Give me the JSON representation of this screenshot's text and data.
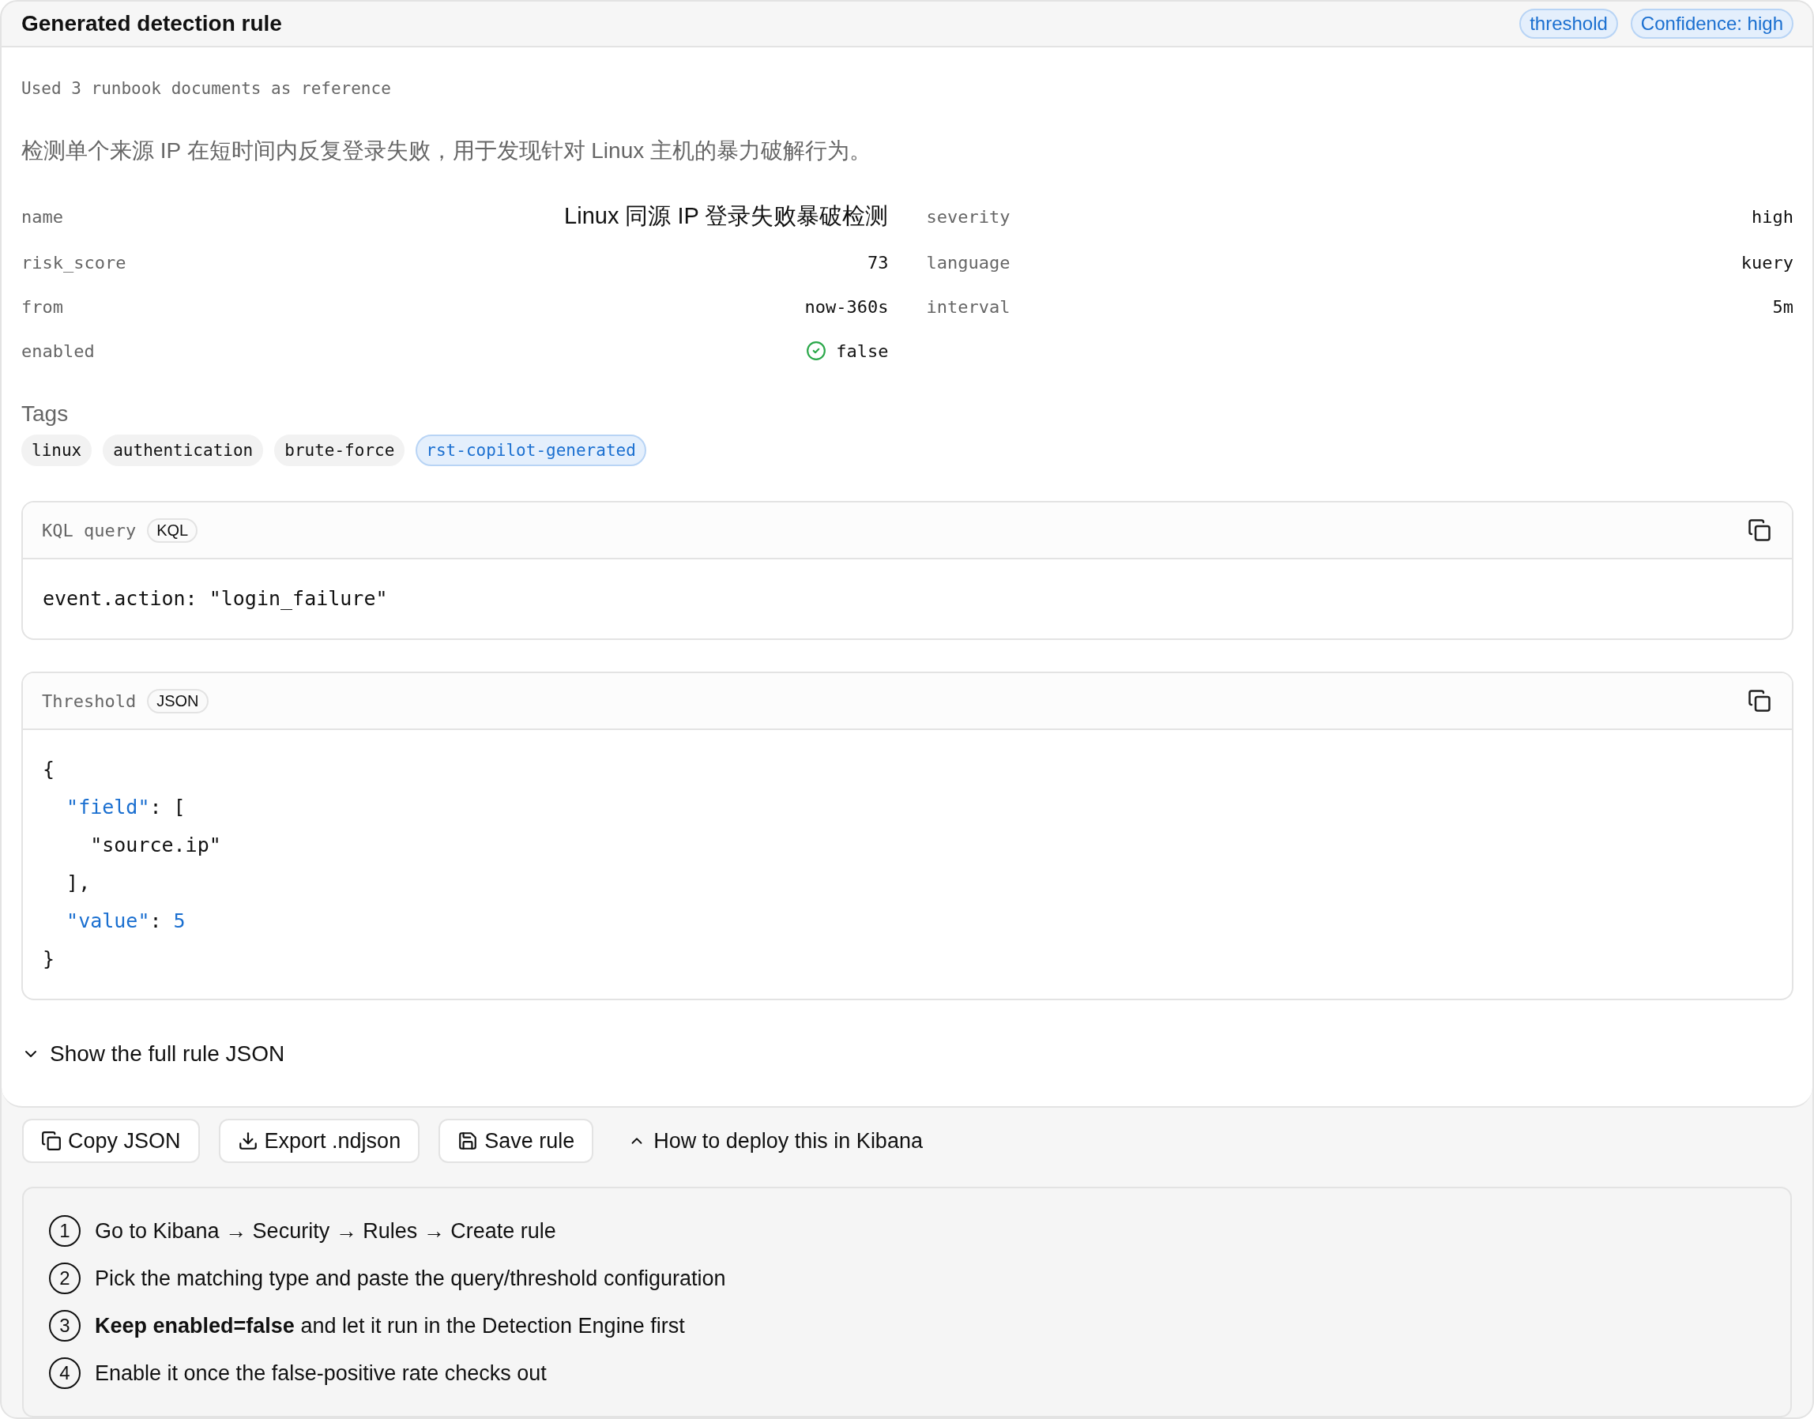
{
  "header": {
    "title": "Generated detection rule",
    "badges": [
      "threshold",
      "Confidence: high"
    ]
  },
  "reference_note": "Used 3 runbook documents as reference",
  "description": "检测单个来源 IP 在短时间内反复登录失败，用于发现针对 Linux 主机的暴力破解行为。",
  "fields": [
    {
      "label": "name",
      "value": "Linux 同源 IP 登录失败暴破检测",
      "kind": "title"
    },
    {
      "label": "severity",
      "value": "high",
      "kind": "mono"
    },
    {
      "label": "risk_score",
      "value": "73",
      "kind": "mono"
    },
    {
      "label": "language",
      "value": "kuery",
      "kind": "mono"
    },
    {
      "label": "from",
      "value": "now-360s",
      "kind": "mono"
    },
    {
      "label": "interval",
      "value": "5m",
      "kind": "mono"
    },
    {
      "label": "enabled",
      "value": "false",
      "kind": "status"
    }
  ],
  "tags": {
    "title": "Tags",
    "items": [
      {
        "label": "linux",
        "highlighted": false
      },
      {
        "label": "authentication",
        "highlighted": false
      },
      {
        "label": "brute-force",
        "highlighted": false
      },
      {
        "label": "rst-copilot-generated",
        "highlighted": true
      }
    ]
  },
  "code_blocks": [
    {
      "title": "KQL query",
      "language": "KQL",
      "lines": [
        [
          {
            "kind": "plain",
            "text": "event.action: \"login_failure\""
          }
        ]
      ]
    },
    {
      "title": "Threshold",
      "language": "JSON",
      "lines": [
        [
          {
            "kind": "plain",
            "text": "{"
          }
        ],
        [
          {
            "kind": "key",
            "text": "  \"field\""
          },
          {
            "kind": "plain",
            "text": ": ["
          }
        ],
        [
          {
            "kind": "plain",
            "text": "    \"source.ip\""
          }
        ],
        [
          {
            "kind": "plain",
            "text": "  ],"
          }
        ],
        [
          {
            "kind": "key",
            "text": "  \"value\""
          },
          {
            "kind": "plain",
            "text": ": "
          },
          {
            "kind": "number",
            "text": "5"
          }
        ],
        [
          {
            "kind": "plain",
            "text": "}"
          }
        ]
      ]
    }
  ],
  "full_json_toggle": {
    "label": "Show the full rule JSON",
    "expanded": false
  },
  "actions": [
    {
      "label": "Copy JSON",
      "kind": "copy"
    },
    {
      "label": "Export .ndjson",
      "kind": "download"
    },
    {
      "label": "Save rule",
      "kind": "save"
    }
  ],
  "deploy_guide": {
    "label": "How to deploy this in Kibana",
    "expanded": true,
    "steps": [
      {
        "number": "1",
        "text": "Go to Kibana → Security → Rules → Create rule"
      },
      {
        "number": "2",
        "text": "Pick the matching type and paste the query/threshold configuration"
      },
      {
        "number": "3",
        "text": "**Keep enabled=false** and let it run in the Detection Engine first"
      },
      {
        "number": "4",
        "text": "Enable it once the false-positive rate checks out"
      }
    ]
  }
}
